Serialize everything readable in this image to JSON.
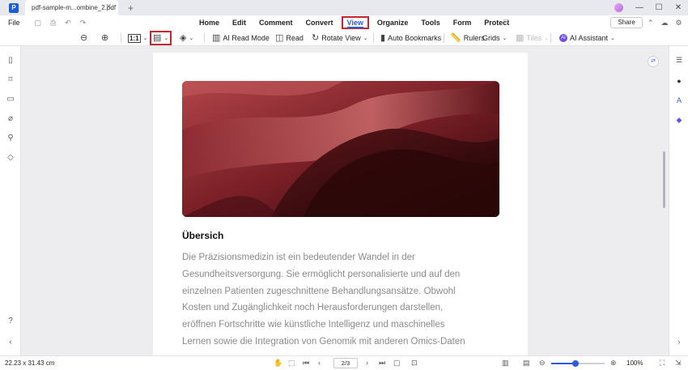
{
  "titlebar": {
    "logo": "P",
    "tab_title": "pdf-sample-m...ombine_2.pdf",
    "tab_close": "✕",
    "new_tab": "+"
  },
  "menubar": {
    "file": "File",
    "tabs": [
      "Home",
      "Edit",
      "Comment",
      "Convert",
      "View",
      "Organize",
      "Tools",
      "Form",
      "Protect"
    ],
    "active_tab": "View",
    "share": "Share"
  },
  "toolbar": {
    "zoom_ratio": "1:1",
    "ai_read_mode": "AI Read Mode",
    "read": "Read",
    "rotate_view": "Rotate View",
    "auto_bookmarks": "Auto Bookmarks",
    "rulers": "Rulers",
    "grids": "Grids",
    "tiles": "Tiles",
    "ai_assistant": "AI Assistant"
  },
  "document": {
    "heading": "Übersich",
    "paragraph_lines": [
      "Die Präzisionsmedizin ist ein bedeutender Wandel in der",
      "Gesundheitsversorgung. Sie ermöglicht personalisierte und auf den",
      "einzelnen Patienten zugeschnittene Behandlungsansätze. Obwohl",
      "Kosten und Zugänglichkeit noch Herausforderungen darstellen,",
      "eröffnen Fortschritte wie künstliche Intelligenz und maschinelles",
      "Lernen sowie die Integration von Genomik mit anderen Omics-Daten"
    ]
  },
  "statusbar": {
    "page_size": "22.23 x 31.43 cm",
    "page_indicator": "2/3",
    "zoom": "100%",
    "zoom_level": 0.45
  },
  "colors": {
    "accent": "#2d5be0",
    "highlight_box": "#c9252f",
    "hero_dark": "#3a0c10",
    "hero_light": "#b0454a"
  }
}
